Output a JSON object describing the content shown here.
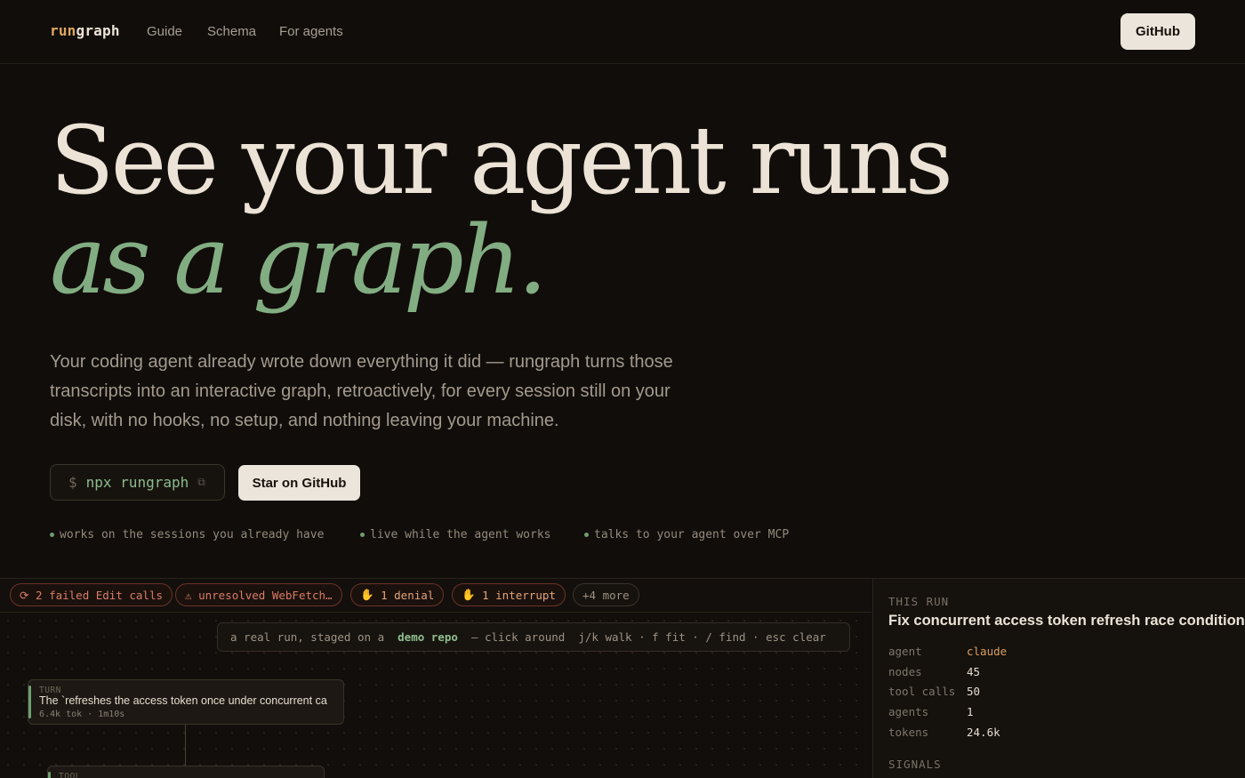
{
  "nav": {
    "logo_a": "run",
    "logo_b": "graph",
    "links": [
      "Guide",
      "Schema",
      "For agents"
    ],
    "github_label": "GitHub"
  },
  "hero": {
    "line1": "See your agent runs",
    "line2": "as a graph.",
    "lede": "Your coding agent already wrote down everything it did — rungraph turns those transcripts into an interactive graph, retroactively, for every session still on your disk, with no hooks, no setup, and nothing leaving your machine.",
    "command_prompt": "$",
    "command": "npx rungraph",
    "copy_icon": "⧉",
    "star_label": "Star on GitHub",
    "features": [
      "works on the sessions you already have",
      "live while the agent works",
      "talks to your agent over MCP"
    ]
  },
  "demo": {
    "chips": [
      {
        "icon": "⟳",
        "label": "2 failed Edit calls"
      },
      {
        "icon": "⚠",
        "label": "unresolved WebFetch…"
      },
      {
        "icon": "✋",
        "label": "1 denial"
      },
      {
        "icon": "✋",
        "label": "1 interrupt"
      },
      {
        "icon": "",
        "label": "+4 more"
      }
    ],
    "hint": {
      "pre": "a real run, staged on a  ",
      "link": "demo repo",
      "post": "  — click around  j/k walk · f fit · / find · esc clear"
    },
    "nodes": [
      {
        "kind": "TURN",
        "title": "The `refreshes the access token once under concurrent ca",
        "meta": "6.4k tok · 1m10s"
      },
      {
        "kind": "TOOL",
        "title": "",
        "meta": ""
      }
    ],
    "side": {
      "label": "THIS RUN",
      "title": "Fix concurrent access token refresh race condition",
      "rows": [
        {
          "key": "agent",
          "value": "claude"
        },
        {
          "key": "nodes",
          "value": "45"
        },
        {
          "key": "tool calls",
          "value": "50"
        },
        {
          "key": "agents",
          "value": "1"
        },
        {
          "key": "tokens",
          "value": "24.6k"
        }
      ],
      "signals_label": "SIGNALS"
    }
  },
  "colors": {
    "background": "#110d0a",
    "accent_green": "#82ad82",
    "accent_orange": "#e0a860",
    "error_red": "#d97c66"
  }
}
